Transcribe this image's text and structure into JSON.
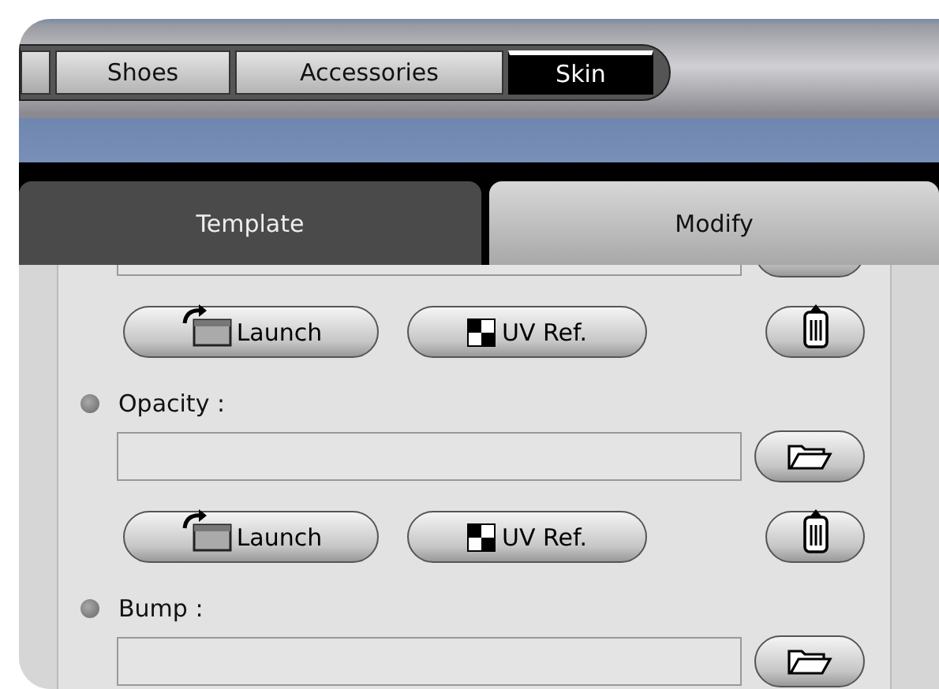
{
  "category_tabs": [
    {
      "label": "Shoes",
      "selected": false
    },
    {
      "label": "Accessories",
      "selected": false
    },
    {
      "label": "Skin",
      "selected": true
    }
  ],
  "mode_tabs": [
    {
      "label": "Template",
      "selected": false
    },
    {
      "label": "Modify",
      "selected": true
    }
  ],
  "rows": [
    {
      "kind": "field"
    },
    {
      "kind": "actions",
      "launch": "Launch",
      "uv_ref": "UV Ref."
    },
    {
      "kind": "label",
      "text": "Opacity :"
    },
    {
      "kind": "field"
    },
    {
      "kind": "actions",
      "launch": "Launch",
      "uv_ref": "UV Ref."
    },
    {
      "kind": "label",
      "text": "Bump :"
    },
    {
      "kind": "field"
    }
  ]
}
